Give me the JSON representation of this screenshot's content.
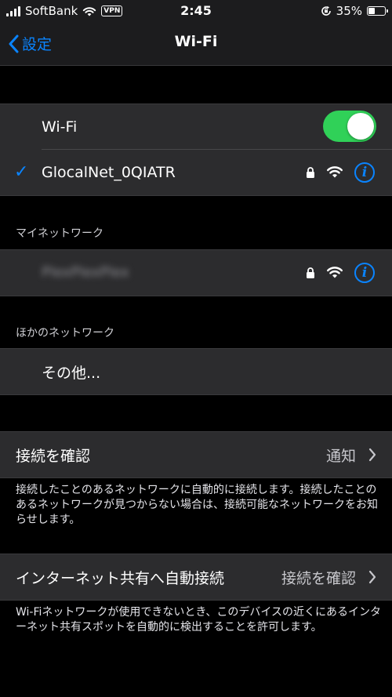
{
  "status_bar": {
    "carrier": "SoftBank",
    "vpn": "VPN",
    "time": "2:45",
    "battery": "35%",
    "icons": [
      "signal-icon",
      "wifi-icon",
      "orientation-lock-icon",
      "battery-icon"
    ]
  },
  "nav": {
    "back_label": "設定",
    "title": "Wi-Fi"
  },
  "wifi_group": {
    "toggle_label": "Wi-Fi",
    "toggle_on": true,
    "connected_network": "GlocalNet_0QIATR"
  },
  "my_networks": {
    "header": "マイネットワーク",
    "network_name": "PlexPlexPlex"
  },
  "other_networks": {
    "header": "ほかのネットワーク",
    "other_label": "その他..."
  },
  "ask_to_join": {
    "label": "接続を確認",
    "value": "通知",
    "description": "接続したことのあるネットワークに自動的に接続します。接続したことのあるネットワークが見つからない場合は、接続可能なネットワークをお知らせします。"
  },
  "hotspot": {
    "label": "インターネット共有へ自動接続",
    "value": "接続を確認",
    "description": "Wi-Fiネットワークが使用できないとき、このデバイスの近くにあるインターネット共有スポットを自動的に検出することを許可します。"
  },
  "colors": {
    "accent": "#0a84ff",
    "toggle_on": "#30d158",
    "cell_bg": "#2c2c2e",
    "background": "#000000"
  }
}
